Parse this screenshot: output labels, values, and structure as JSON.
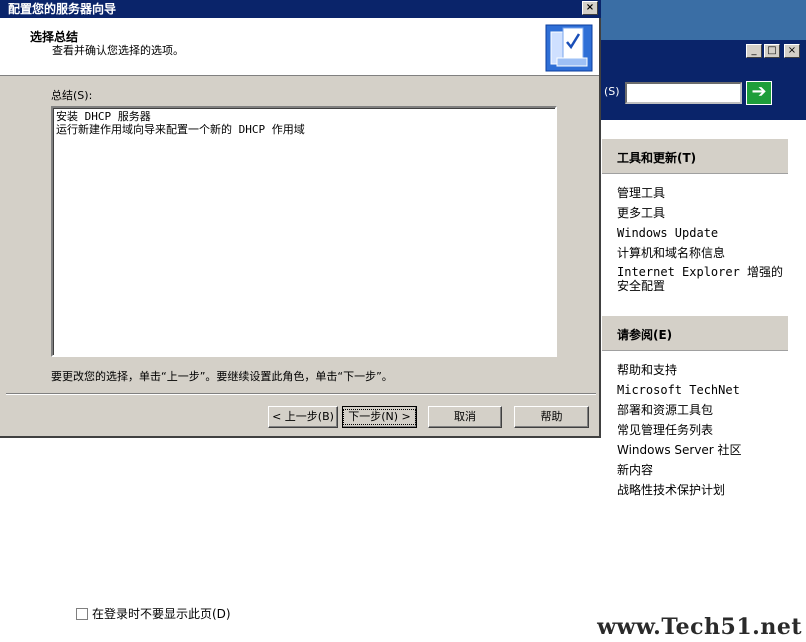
{
  "wizard": {
    "title": "配置您的服务器向导",
    "close_glyph": "×",
    "heading": "选择总结",
    "subheading": "查看并确认您选择的选项。",
    "summary_label": "总结(S):",
    "summary_lines": [
      "安装 DHCP 服务器",
      "运行新建作用域向导来配置一个新的 DHCP 作用域"
    ],
    "instruction": "要更改您的选择，单击“上一步”。要继续设置此角色，单击“下一步”。",
    "buttons": {
      "back": "< 上一步(B)",
      "next": "下一步(N) >",
      "cancel": "取消",
      "help": "帮助"
    }
  },
  "background_window": {
    "search_label": "(S)",
    "go_icon": "arrow-right-icon",
    "tools_pane": {
      "title": "工具和更新(T)",
      "items": [
        "管理工具",
        "更多工具",
        "Windows Update",
        "计算机和域名称信息",
        "Internet Explorer 增强的安全配置"
      ]
    },
    "see_also_pane": {
      "title": "请参阅(E)",
      "items": [
        "帮助和支持",
        "Microsoft TechNet",
        "部署和资源工具包",
        "常见管理任务列表",
        "Windows Server 社区",
        "新内容",
        "战略性技术保护计划"
      ]
    },
    "dont_show_label": "在登录时不要显示此页(D)",
    "dont_show_checked": false
  },
  "watermark": "www.Tech51.net",
  "colors": {
    "titlebar": "#0a246a",
    "face": "#d4d0c8",
    "desktop": "#3a6ea5",
    "go_button": "#1e9e3a"
  }
}
